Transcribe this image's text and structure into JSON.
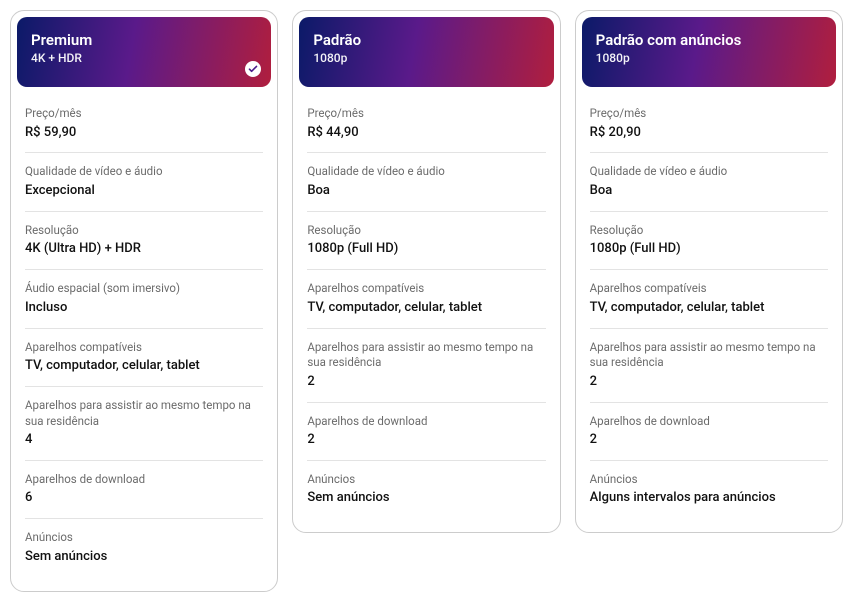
{
  "plans": [
    {
      "title": "Premium",
      "subtitle": "4K + HDR",
      "selected": true,
      "specs": [
        {
          "label": "Preço/mês",
          "value": "R$ 59,90"
        },
        {
          "label": "Qualidade de vídeo e áudio",
          "value": "Excepcional"
        },
        {
          "label": "Resolução",
          "value": "4K (Ultra HD) + HDR"
        },
        {
          "label": "Áudio espacial (som imersivo)",
          "value": "Incluso"
        },
        {
          "label": "Aparelhos compatíveis",
          "value": "TV, computador, celular, tablet"
        },
        {
          "label": "Aparelhos para assistir ao mesmo tempo na sua residência",
          "value": "4"
        },
        {
          "label": "Aparelhos de download",
          "value": "6"
        },
        {
          "label": "Anúncios",
          "value": "Sem anúncios"
        }
      ]
    },
    {
      "title": "Padrão",
      "subtitle": "1080p",
      "selected": false,
      "specs": [
        {
          "label": "Preço/mês",
          "value": "R$ 44,90"
        },
        {
          "label": "Qualidade de vídeo e áudio",
          "value": "Boa"
        },
        {
          "label": "Resolução",
          "value": "1080p (Full HD)"
        },
        {
          "label": "Aparelhos compatíveis",
          "value": "TV, computador, celular, tablet"
        },
        {
          "label": "Aparelhos para assistir ao mesmo tempo na sua residência",
          "value": "2"
        },
        {
          "label": "Aparelhos de download",
          "value": "2"
        },
        {
          "label": "Anúncios",
          "value": "Sem anúncios"
        }
      ]
    },
    {
      "title": "Padrão com anúncios",
      "subtitle": "1080p",
      "selected": false,
      "specs": [
        {
          "label": "Preço/mês",
          "value": "R$ 20,90"
        },
        {
          "label": "Qualidade de vídeo e áudio",
          "value": "Boa"
        },
        {
          "label": "Resolução",
          "value": "1080p (Full HD)"
        },
        {
          "label": "Aparelhos compatíveis",
          "value": "TV, computador, celular, tablet"
        },
        {
          "label": "Aparelhos para assistir ao mesmo tempo na sua residência",
          "value": "2"
        },
        {
          "label": "Aparelhos de download",
          "value": "2"
        },
        {
          "label": "Anúncios",
          "value": "Alguns intervalos para anúncios"
        }
      ]
    }
  ]
}
